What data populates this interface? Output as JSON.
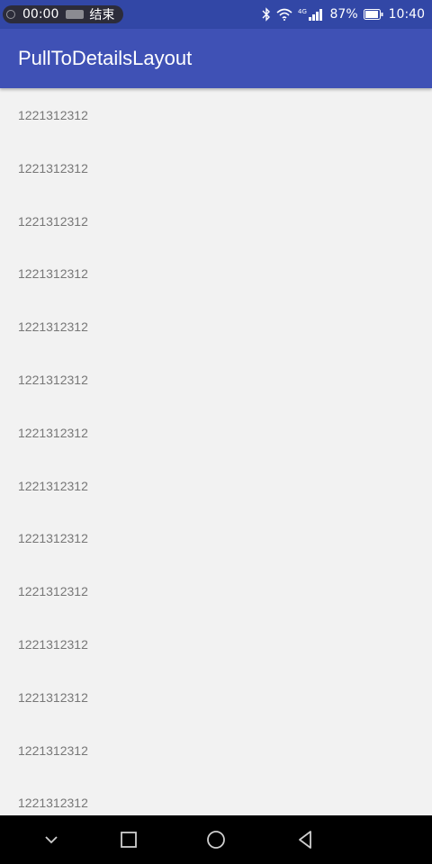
{
  "status_bar": {
    "recording_time": "00:00",
    "recording_stop_label": "结束",
    "signal_label": "4G",
    "battery_percent": "87%",
    "clock": "10:40",
    "icons": [
      "bluetooth-icon",
      "wifi-icon",
      "cell-signal-icon",
      "battery-icon"
    ]
  },
  "app_bar": {
    "title": "PullToDetailsLayout"
  },
  "list": {
    "items": [
      {
        "label": "1221312312"
      },
      {
        "label": "1221312312"
      },
      {
        "label": "1221312312"
      },
      {
        "label": "1221312312"
      },
      {
        "label": "1221312312"
      },
      {
        "label": "1221312312"
      },
      {
        "label": "1221312312"
      },
      {
        "label": "1221312312"
      },
      {
        "label": "1221312312"
      },
      {
        "label": "1221312312"
      },
      {
        "label": "1221312312"
      },
      {
        "label": "1221312312"
      },
      {
        "label": "1221312312"
      },
      {
        "label": "1221312312"
      }
    ]
  },
  "nav_bar": {
    "buttons": [
      "chevron-down-icon",
      "recents-square-icon",
      "home-circle-icon",
      "back-triangle-icon"
    ]
  },
  "colors": {
    "status_bar": "#3247a6",
    "app_bar": "#3f51b5",
    "background": "#f2f2f2",
    "list_text": "#777777",
    "nav_bar": "#000000"
  }
}
